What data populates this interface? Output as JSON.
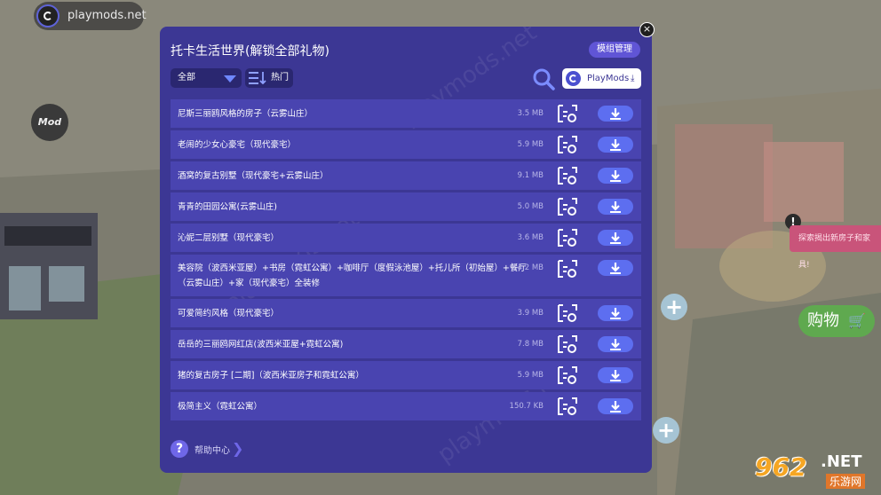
{
  "background": {
    "watermark_badge": "playmods.net",
    "mod_badge": "Mod",
    "side_tag": "探索揭出新房子和家具!",
    "alert": "!",
    "shop_button": "购物",
    "plus_button": "+",
    "site_watermark": {
      "number": "962",
      "suffix": ".NET",
      "cn": "乐游网"
    }
  },
  "dialog": {
    "title": "托卡生活世界(解锁全部礼物)",
    "manage_button": "模组管理",
    "close_icon": "×",
    "filter": {
      "selected": "全部"
    },
    "sort_label": "热门",
    "playmods_button": "PlayMods",
    "download_arrow": "⤓",
    "watermark_text": "playmods.net",
    "items": [
      {
        "name": "尼斯三丽鸥风格的房子（云雾山庄）",
        "size": "3.5 MB"
      },
      {
        "name": "老闹的少女心豪宅（现代豪宅）",
        "size": "5.9 MB"
      },
      {
        "name": "酒窝的复古别墅（现代豪宅+云雾山庄）",
        "size": "9.1 MB"
      },
      {
        "name": "青青的田园公寓(云雾山庄)",
        "size": "5.0 MB"
      },
      {
        "name": "沁妮二层别墅（现代豪宅）",
        "size": "3.6 MB"
      },
      {
        "name": "美容院（波西米亚屋）+书房（霓虹公寓）+咖啡厅（度假泳池屋）+托儿所（初始屋）+餐厅",
        "name2": "（云雾山庄）+家（现代豪宅）全装修",
        "size": "4.2 MB"
      },
      {
        "name": "可爱简约风格（现代豪宅）",
        "size": "3.9 MB"
      },
      {
        "name": "岳岳的三丽鸥网红店(波西米亚屋+霓虹公寓)",
        "size": "7.8 MB"
      },
      {
        "name": "猪的复古房子 [二期]（波西米亚房子和霓虹公寓）",
        "size": "5.9 MB"
      },
      {
        "name": "极简主义（霓虹公寓）",
        "size": "150.7 KB"
      }
    ],
    "help_label": "帮助中心",
    "help_icon": "?",
    "help_chevron": "❯"
  },
  "colors": {
    "dialog_bg": "#3c3794",
    "row_bg": "#4944b0",
    "accent": "#5d6ef0"
  }
}
